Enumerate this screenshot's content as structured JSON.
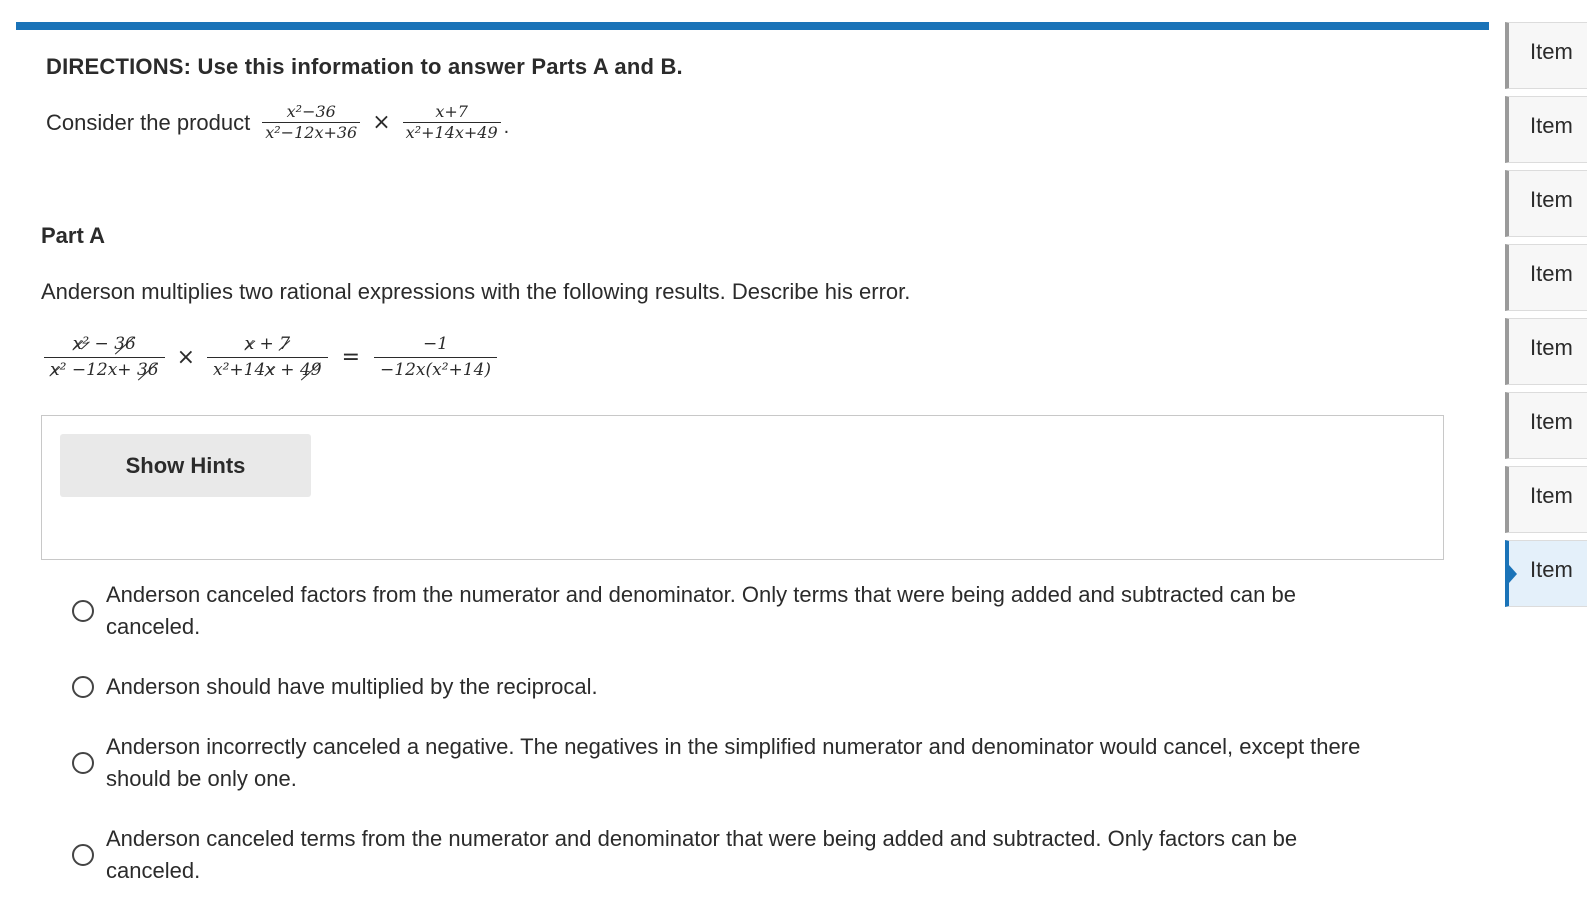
{
  "directions": "DIRECTIONS: Use this information to answer Parts A and B.",
  "consider": {
    "lead": "Consider the product",
    "frac1": {
      "num": "x²−36",
      "den": "x²−12x+36"
    },
    "times": "×",
    "frac2": {
      "num": "x+7",
      "den": "x²+14x+49"
    },
    "period": "."
  },
  "partA": {
    "title": "Part A",
    "prompt": "Anderson multiplies two rational expressions with the following results. Describe his error.",
    "work": {
      "f1": {
        "num": [
          "x",
          "²",
          " − ",
          "36"
        ],
        "den": [
          "x",
          "²",
          " −12x+ ",
          "36"
        ]
      },
      "times": "×",
      "f2": {
        "num": [
          "x",
          " + ",
          "7"
        ],
        "den": [
          "x²+14",
          "x",
          " + ",
          "49"
        ]
      },
      "equals": "=",
      "result": {
        "num": "−1",
        "den": "−12x(x²+14)"
      }
    },
    "hint_button": "Show Hints",
    "options": [
      "Anderson canceled factors from the numerator and denominator. Only terms that were being added and subtracted can be canceled.",
      "Anderson should have multiplied by the reciprocal.",
      "Anderson incorrectly canceled a negative. The negatives in the simplified numerator and denominator would cancel, except there should be only one.",
      "Anderson canceled terms from the numerator and denominator that were being added and subtracted. Only factors can be canceled."
    ]
  },
  "rail": {
    "items": [
      "Item",
      "Item",
      "Item",
      "Item",
      "Item",
      "Item",
      "Item",
      "Item"
    ],
    "active_index": 7
  },
  "colors": {
    "accent": "#1a73b8",
    "button_bg": "#e9e9e9",
    "active_item_bg": "#e4f0fa"
  }
}
